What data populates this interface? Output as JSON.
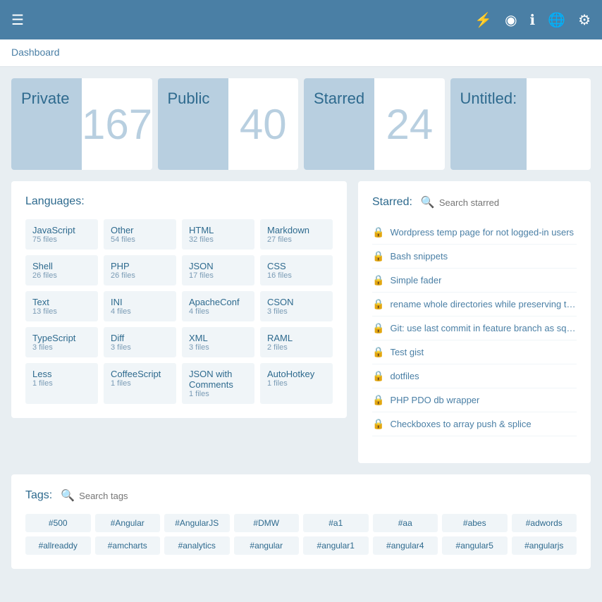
{
  "header": {
    "hamburger_label": "☰",
    "lightning_label": "⚡",
    "profile_label": "○",
    "info_label": "ⓘ",
    "globe_label": "⊕",
    "gear_label": "⚙"
  },
  "breadcrumb": {
    "text": "Dashboard"
  },
  "stats": [
    {
      "label": "Private",
      "number": "167"
    },
    {
      "label": "Public",
      "number": "40"
    },
    {
      "label": "Starred",
      "number": "24"
    },
    {
      "label": "Untitled:",
      "number": ""
    }
  ],
  "languages": {
    "title": "Languages:",
    "items": [
      {
        "name": "JavaScript",
        "count": "75 files"
      },
      {
        "name": "Other",
        "count": "54 files"
      },
      {
        "name": "HTML",
        "count": "32 files"
      },
      {
        "name": "Markdown",
        "count": "27 files"
      },
      {
        "name": "Shell",
        "count": "26 files"
      },
      {
        "name": "PHP",
        "count": "26 files"
      },
      {
        "name": "JSON",
        "count": "17 files"
      },
      {
        "name": "CSS",
        "count": "16 files"
      },
      {
        "name": "Text",
        "count": "13 files"
      },
      {
        "name": "INI",
        "count": "4 files"
      },
      {
        "name": "ApacheConf",
        "count": "4 files"
      },
      {
        "name": "CSON",
        "count": "3 files"
      },
      {
        "name": "TypeScript",
        "count": "3 files"
      },
      {
        "name": "Diff",
        "count": "3 files"
      },
      {
        "name": "XML",
        "count": "3 files"
      },
      {
        "name": "RAML",
        "count": "2 files"
      },
      {
        "name": "Less",
        "count": "1 files"
      },
      {
        "name": "CoffeeScript",
        "count": "1 files"
      },
      {
        "name": "JSON with Comments",
        "count": "1 files"
      },
      {
        "name": "AutoHotkey",
        "count": "1 files"
      }
    ]
  },
  "starred": {
    "title": "Starred:",
    "search_placeholder": "Search starred",
    "items": [
      "Wordpress temp page for not logged-in users",
      "Bash snippets",
      "Simple fader",
      "rename whole directories while preserving th...",
      "Git: use last commit in feature branch as squ...",
      "Test gist",
      "dotfiles",
      "PHP PDO db wrapper",
      "Checkboxes to array push & splice"
    ]
  },
  "tags": {
    "title": "Tags:",
    "search_placeholder": "Search tags",
    "row1": [
      "#500",
      "#Angular",
      "#AngularJS",
      "#DMW",
      "#a1",
      "#aa",
      "#abes",
      "#adwords"
    ],
    "row2": [
      "#allreaddy",
      "#amcharts",
      "#analytics",
      "#angular",
      "#angular1",
      "#angular4",
      "#angular5",
      "#angularjs"
    ]
  }
}
